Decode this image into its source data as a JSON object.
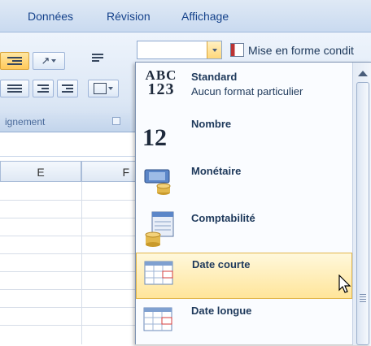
{
  "tabs": [
    "Données",
    "Révision",
    "Affichage"
  ],
  "ribbon": {
    "group_label": "ignement",
    "format_box_value": "",
    "conditional_format_label": "Mise en forme condit"
  },
  "sheet": {
    "columns": [
      "E",
      "F"
    ]
  },
  "number_formats": [
    {
      "title": "Standard",
      "subtitle": "Aucun format particulier",
      "icon": "abc-123-icon",
      "icon_text_top": "ABC",
      "icon_text_bottom": "123"
    },
    {
      "title": "Nombre",
      "subtitle": "",
      "icon": "number-12-icon",
      "icon_text_top": "12"
    },
    {
      "title": "Monétaire",
      "subtitle": "",
      "icon": "currency-icon"
    },
    {
      "title": "Comptabilité",
      "subtitle": "",
      "icon": "accounting-icon"
    },
    {
      "title": "Date courte",
      "subtitle": "",
      "icon": "calendar-icon",
      "hovered": true
    },
    {
      "title": "Date longue",
      "subtitle": "",
      "icon": "calendar-icon"
    }
  ],
  "colors": {
    "accent": "#15428b",
    "hover_fill": "#ffe59a",
    "hover_border": "#e2b64a"
  }
}
